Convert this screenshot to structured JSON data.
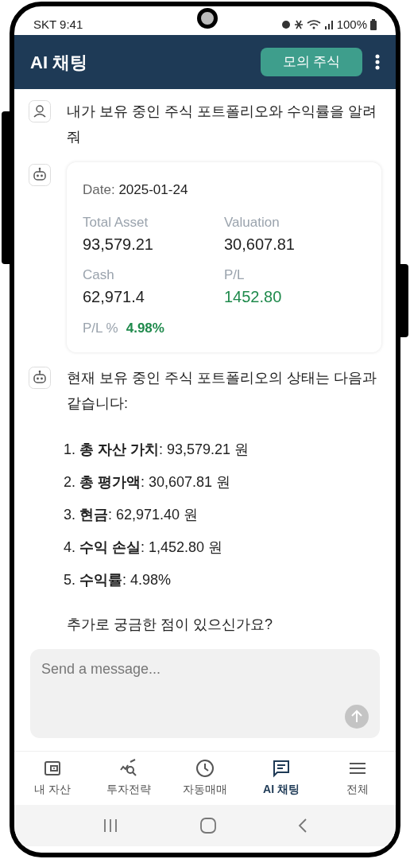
{
  "status_bar": {
    "carrier_time": "SKT 9:41",
    "battery": "100%"
  },
  "header": {
    "title": "AI 채팅",
    "mode_button": "모의 주식"
  },
  "messages": [
    {
      "kind": "user_text",
      "text": "내가 보유 중인 주식 포트폴리오와 수익률을 알려줘"
    },
    {
      "kind": "bot_card",
      "date_label": "Date:",
      "date": "2025-01-24",
      "fields": [
        {
          "label": "Total Asset",
          "value": "93,579.21",
          "positive": false
        },
        {
          "label": "Valuation",
          "value": "30,607.81",
          "positive": false
        },
        {
          "label": "Cash",
          "value": "62,971.4",
          "positive": false
        },
        {
          "label": "P/L",
          "value": "1452.80",
          "positive": true
        }
      ],
      "pl_percent": {
        "label": "P/L %",
        "value": "4.98%",
        "positive": true
      }
    },
    {
      "kind": "bot_list",
      "intro": "현재 보유 중인 주식 포트폴리오의 상태는 다음과 같습니다:",
      "items": [
        "1. **총 자산 가치**: 93,579.21 원",
        "2. **총 평가액**: 30,607.81 원",
        "3. **현금**: 62,971.40 원",
        "4. **수익 손실**: 1,452.80 원",
        "5. **수익률**: 4.98%"
      ],
      "outro": "추가로 궁금한 점이 있으신가요?"
    }
  ],
  "input": {
    "placeholder": "Send a message..."
  },
  "nav": [
    {
      "label": "내 자산",
      "selected": false
    },
    {
      "label": "투자전략",
      "selected": false
    },
    {
      "label": "자동매매",
      "selected": false
    },
    {
      "label": "AI 채팅",
      "selected": true
    },
    {
      "label": "전체",
      "selected": false
    }
  ]
}
